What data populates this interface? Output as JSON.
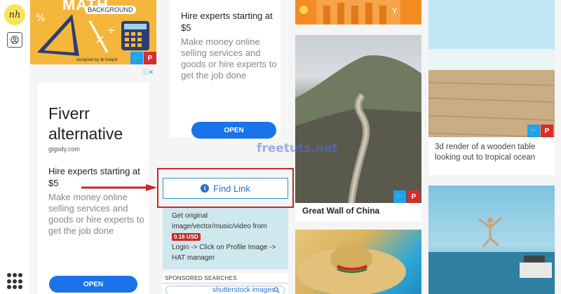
{
  "sidebar": {
    "logo_text": "nh",
    "profile_icon": "user-circle-icon",
    "apps_icon": "grid-dots-icon"
  },
  "pin_math": {
    "title": "MATH",
    "subtitle": "BACKGROUND",
    "credit": "designed by ✿ freepik"
  },
  "ad_left": {
    "ad_choice": "ⓘ✕",
    "brand": "Fiverr alternative",
    "domain": "gigsdy.com",
    "headline": "Hire experts starting at $5",
    "description": "Make money online selling services and goods or hire experts to get the job done",
    "button": "OPEN"
  },
  "ad_middle": {
    "headline": "Hire experts starting at $5",
    "description": "Make money online selling services and goods or hire experts to get the job done",
    "button": "OPEN"
  },
  "find_link": {
    "label": "Find Link"
  },
  "info_panel": {
    "line1": "Get original image/vector/music/video from",
    "price": "0.16 USD",
    "line2": "Login -> Click on Profile Image -> HAT manager"
  },
  "sponsored": {
    "title": "SPONSORED SEARCHES",
    "query": "shutterstock images"
  },
  "pins": {
    "great_wall_caption": "Great Wall of China",
    "deck_caption": "3d render of a wooden table looking out to tropical ocean"
  },
  "watermark": "freetuts.net",
  "colors": {
    "open_button": "#1a73e8",
    "highlight": "#c62828",
    "twitter": "#1da1f2",
    "pinterest": "#d32f2f",
    "info_panel_bg": "#cfe8ee"
  }
}
